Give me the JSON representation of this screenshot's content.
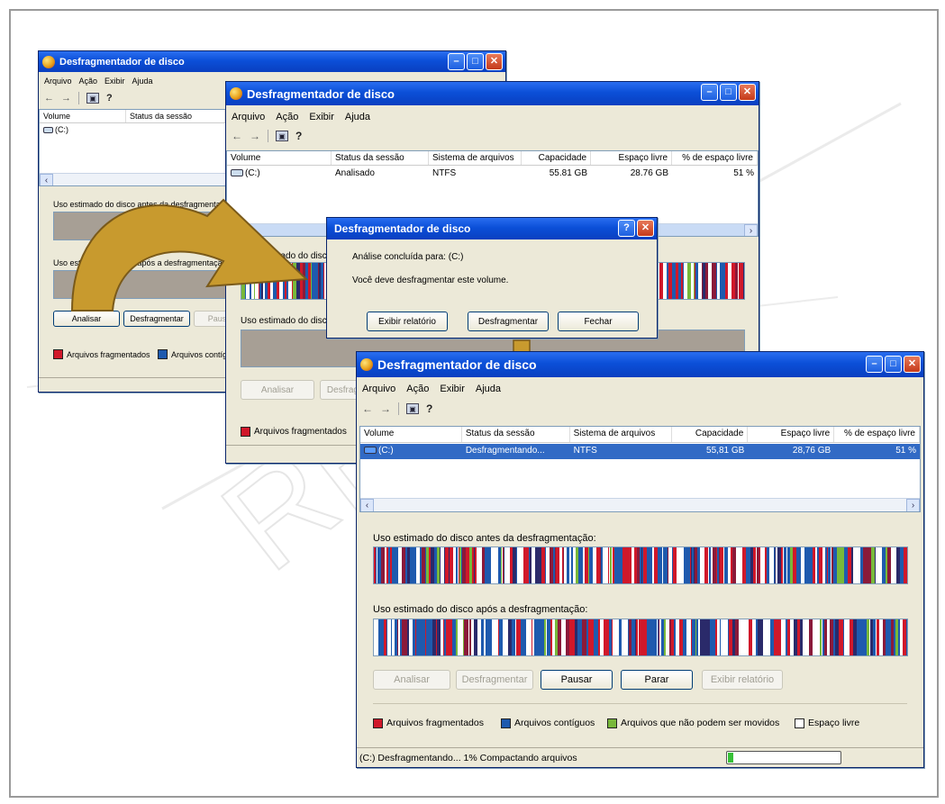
{
  "app_title": "Desfragmentador de disco",
  "watermark_text": "REVISÃO",
  "menu": [
    "Arquivo",
    "Ação",
    "Exibir",
    "Ajuda"
  ],
  "columns": [
    "Volume",
    "Status da sessão",
    "Sistema de arquivos",
    "Capacidade",
    "Espaço livre",
    "% de espaço livre"
  ],
  "window1": {
    "volume": "(C:)",
    "before_label": "Uso estimado do disco antes da desfragmentação:",
    "after_label": "Uso estimado do disco após a desfragmentação:",
    "buttons": [
      "Analisar",
      "Desfragmentar",
      "Pausar"
    ],
    "legend": [
      "Arquivos fragmentados",
      "Arquivos contíguos"
    ]
  },
  "window2": {
    "row": [
      "(C:)",
      "Analisado",
      "NTFS",
      "55.81 GB",
      "28.76 GB",
      "51 %"
    ],
    "before_label": "Uso estimado do disco antes da desfragmentação:",
    "after_label": "Uso estimado do disco após a desfragmentação:",
    "buttons": [
      "Analisar",
      "Desfragmentar"
    ],
    "legend": [
      "Arquivos fragmentados"
    ]
  },
  "dialog": {
    "title": "Desfragmentador de disco",
    "line1": "Análise concluída para: (C:)",
    "line2": "Você deve desfragmentar este volume.",
    "buttons": [
      "Exibir relatório",
      "Desfragmentar",
      "Fechar"
    ]
  },
  "window3": {
    "row": [
      "(C:)",
      "Desfragmentando...",
      "NTFS",
      "55,81 GB",
      "28,76 GB",
      "51 %"
    ],
    "before_label": "Uso estimado do disco antes da desfragmentação:",
    "after_label": "Uso estimado do disco após a desfragmentação:",
    "buttons": [
      "Analisar",
      "Desfragmentar",
      "Pausar",
      "Parar",
      "Exibir relatório"
    ],
    "legend": [
      "Arquivos fragmentados",
      "Arquivos contíguos",
      "Arquivos que não podem ser movidos",
      "Espaço livre"
    ],
    "status": "(C:) Desfragmentando... 1% Compactando arquivos",
    "progress_fraction": 0.01
  },
  "colors": {
    "fragmented": "#d0182a",
    "contiguous": "#1e5aae",
    "unmovable": "#78b83a",
    "free": "#ffffff",
    "title_blue": "#0b4fd8",
    "window_bg": "#ece9d8",
    "arrow": "#c89a2e",
    "selection": "#316ac5"
  }
}
